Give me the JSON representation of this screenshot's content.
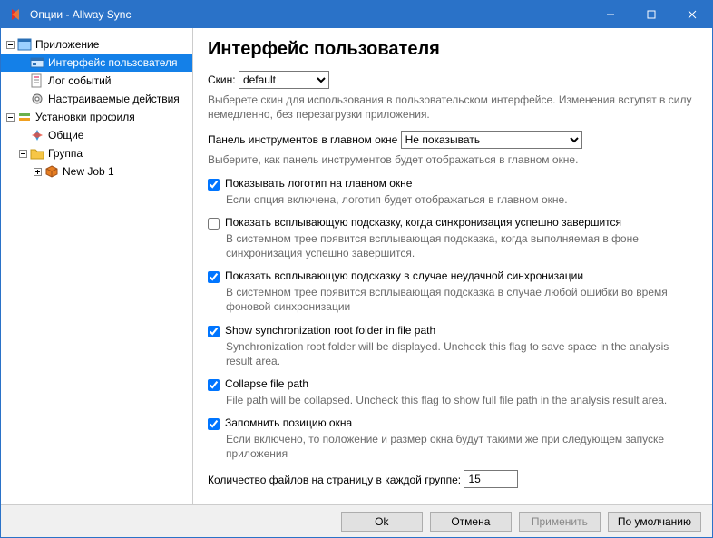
{
  "title": "Опции - Allway Sync",
  "sidebar": {
    "items": [
      {
        "label": "Приложение"
      },
      {
        "label": "Интерфейс пользователя"
      },
      {
        "label": "Лог событий"
      },
      {
        "label": "Настраиваемые действия"
      },
      {
        "label": "Установки профиля"
      },
      {
        "label": "Общие"
      },
      {
        "label": "Группа"
      },
      {
        "label": "New Job 1"
      }
    ]
  },
  "page": {
    "heading": "Интерфейс пользователя",
    "skin_label": "Скин:",
    "skin_value": "default",
    "skin_desc": "Выберете скин для использования в пользовательском интерфейсе. Изменения вступят в силу немедленно, без перезагрузки приложения.",
    "toolbar_label": "Панель инструментов в главном окне",
    "toolbar_value": "Не показывать",
    "toolbar_desc": "Выберите, как панель инструментов будет отображаться в главном окне.",
    "opts": [
      {
        "label": "Показывать логотип на главном окне",
        "desc": "Если опция включена, логотип будет отображаться в главном окне.",
        "checked": true
      },
      {
        "label": "Показать всплывающую подсказку, когда синхронизация успешно завершится",
        "desc": "В системном трее появится всплывающая подсказка, когда выполняемая в фоне синхронизация успешно завершится.",
        "checked": false
      },
      {
        "label": "Показать всплывающую подсказку в случае неудачной синхронизации",
        "desc": "В системном трее появится всплывающая подсказка в случае любой ошибки во время фоновой синхронизации",
        "checked": true
      },
      {
        "label": "Show synchronization root folder in file path",
        "desc": "Synchronization root folder will be displayed. Uncheck this flag to save space in the analysis result area.",
        "checked": true
      },
      {
        "label": "Collapse file path",
        "desc": "File path will be collapsed. Uncheck this flag to show full file path in the analysis result area.",
        "checked": true
      },
      {
        "label": "Запомнить позицию окна",
        "desc": "Если включено, то положение и размер окна будут такими же при следующем запуске приложения",
        "checked": true
      }
    ],
    "files_per_page_label": "Количество файлов на страницу в каждой группе:",
    "files_per_page_value": "15"
  },
  "footer": {
    "ok": "Ok",
    "cancel": "Отмена",
    "apply": "Применить",
    "default": "По умолчанию"
  }
}
